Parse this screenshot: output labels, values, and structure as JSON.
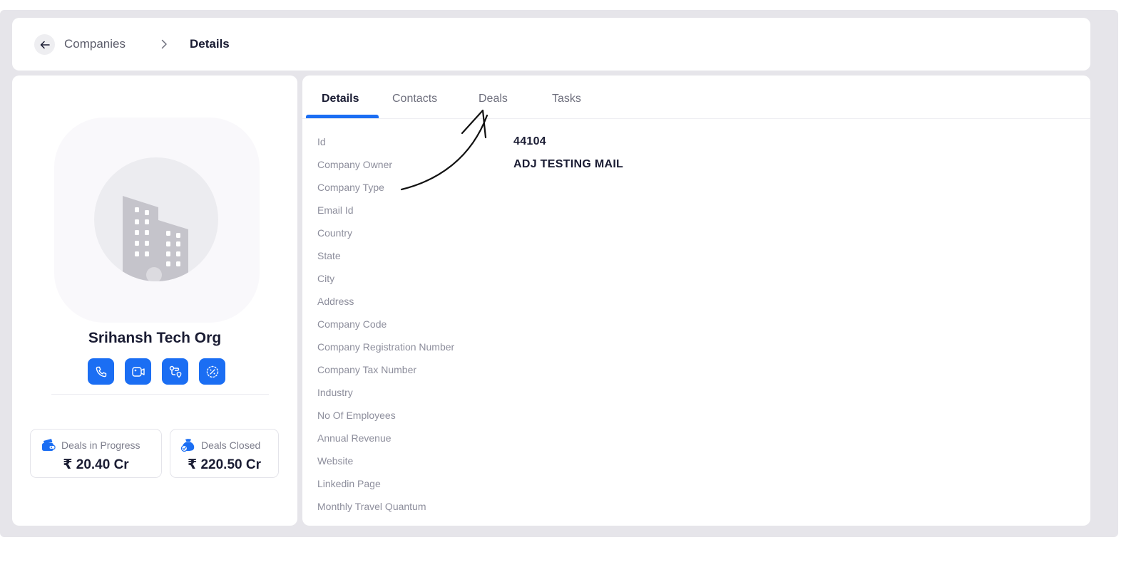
{
  "breadcrumb": {
    "back_icon": "arrow-left-icon",
    "parent": "Companies",
    "separator_icon": "chevron-right-icon",
    "current": "Details"
  },
  "company": {
    "name": "Srihansh Tech Org",
    "avatar_icon": "building-icon",
    "actions": [
      {
        "icon": "phone-icon"
      },
      {
        "icon": "video-call-icon"
      },
      {
        "icon": "route-pin-icon"
      },
      {
        "icon": "discount-badge-icon"
      }
    ],
    "stats": [
      {
        "icon": "wallet-cards-icon",
        "label": "Deals in Progress",
        "value": "₹ 20.40 Cr"
      },
      {
        "icon": "money-bag-check-icon",
        "label": "Deals Closed",
        "value": "₹ 220.50 Cr"
      }
    ]
  },
  "tabs": [
    "Details",
    "Contacts",
    "Deals",
    "Tasks"
  ],
  "active_tab": "Details",
  "fields": [
    {
      "label": "Id",
      "value": "44104"
    },
    {
      "label": "Company Owner",
      "value": "ADJ TESTING MAIL"
    },
    {
      "label": "Company Type",
      "value": ""
    },
    {
      "label": "Email Id",
      "value": ""
    },
    {
      "label": "Country",
      "value": ""
    },
    {
      "label": "State",
      "value": ""
    },
    {
      "label": "City",
      "value": ""
    },
    {
      "label": "Address",
      "value": ""
    },
    {
      "label": "Company Code",
      "value": ""
    },
    {
      "label": "Company Registration Number",
      "value": ""
    },
    {
      "label": "Company Tax Number",
      "value": ""
    },
    {
      "label": "Industry",
      "value": ""
    },
    {
      "label": "No Of Employees",
      "value": ""
    },
    {
      "label": "Annual Revenue",
      "value": ""
    },
    {
      "label": "Website",
      "value": ""
    },
    {
      "label": "Linkedin Page",
      "value": ""
    },
    {
      "label": "Monthly Travel Quantum",
      "value": ""
    }
  ],
  "colors": {
    "accent": "#1b6ef3",
    "background_frame": "#e6e5ea",
    "text_primary": "#1a1c33",
    "text_muted": "#8d8e9c"
  },
  "annotation_icon": "hand-drawn-arrow-icon"
}
